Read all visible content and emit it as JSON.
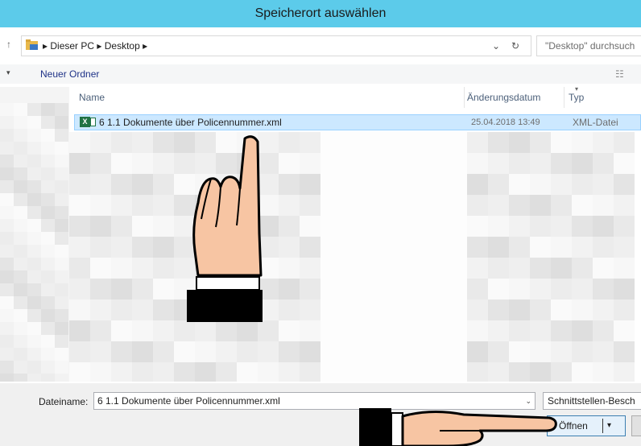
{
  "window": {
    "title": "Speicherort auswählen"
  },
  "address": {
    "crumbs": [
      "Dieser PC",
      "Desktop"
    ],
    "dropdown_glyph": "⌄",
    "refresh_glyph": "↻",
    "search_placeholder": "\"Desktop\" durchsuch",
    "nav_glyph": "↑"
  },
  "toolbar": {
    "new_folder": "Neuer Ordner",
    "organize_glyph": "▾",
    "view_glyph": "☷"
  },
  "columns": {
    "name": "Name",
    "date": "Änderungsdatum",
    "type": "Typ"
  },
  "file": {
    "name": "6 1.1 Dokumente über Policennummer.xml",
    "date": "25.04.2018 13:49",
    "type": "XML-Datei",
    "icon": "excel-icon",
    "icon_letter": "X"
  },
  "footer": {
    "filename_label": "Dateiname:",
    "filename_value": "6 1.1 Dokumente über Policennummer.xml",
    "filter_value": "Schnittstellen-Besch",
    "open_label": "Öffnen",
    "dropdown_glyph": "⌄",
    "split_glyph": "▾"
  },
  "colors": {
    "titlebar": "#5ccbea",
    "selection": "#cce8ff",
    "accent": "#1e3287"
  }
}
